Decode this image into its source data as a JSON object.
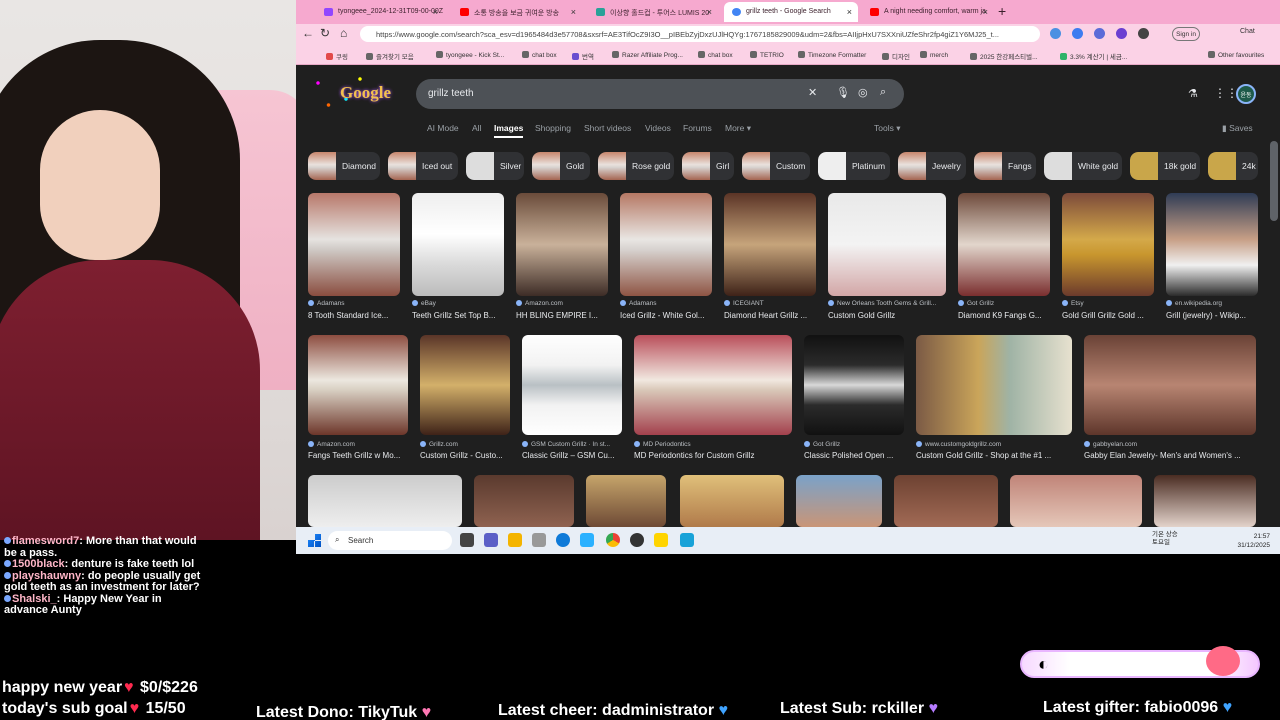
{
  "chat": [
    {
      "user": "flamesword7",
      "text": "More than that would be a pass."
    },
    {
      "user": "1500black",
      "text": "denture is fake teeth lol"
    },
    {
      "user": "playshauwny",
      "text": "do people usually get gold teeth as an investment for later?"
    },
    {
      "user": "Shalski_",
      "text": "Happy New Year in advance Aunty"
    }
  ],
  "overlay": {
    "greeting": "happy new year",
    "greeting_amount": "$0/$226",
    "sub_goal": "today's sub goal",
    "sub_goal_value": "15/50",
    "latest_dono": "Latest Dono: TikyTuk",
    "latest_cheer": "Latest cheer: dadministrator",
    "latest_sub": "Latest Sub: rckiller",
    "latest_gifter": "Latest gifter: fabio0096"
  },
  "browser": {
    "tabs": [
      {
        "title": "tyongeee_2024-12-31T09-00-00Z"
      },
      {
        "title": "소통 방송을 보금 귀여운 방송"
      },
      {
        "title": "이상향 홀드컵 - 투어스 LUMIS 20"
      },
      {
        "title": "grillz teeth - Google Search"
      },
      {
        "title": "A night needing comfort, warm ja"
      }
    ],
    "url": "https://www.google.com/search?sca_esv=d1965484d3e57708&sxsrf=AE3TifOcZ9I3O__pIBEbZyjDxzUJlHQYg:1767185829009&udm=2&fbs=AIIjpHxU7SXXniUZfeShr2fp4giZ1Y6MJ25_t...",
    "signin": "Sign in",
    "chat_btn": "Chat",
    "bookmarks": [
      "쿠링",
      "즐겨찾기 모음",
      "tyongeee - Kick St...",
      "chat box",
      "번역",
      "Razer Affiliate Prog...",
      "chat box",
      "TETRIO",
      "Timezone Formatter",
      "디자인",
      "merch",
      "2025 한강페스티벌...",
      "3.3% 계산기 | 세금..."
    ],
    "other_favourites": "Other favourites"
  },
  "google": {
    "logo": "Google",
    "query": "grillz teeth",
    "tabs": [
      "AI Mode",
      "All",
      "Images",
      "Shopping",
      "Short videos",
      "Videos",
      "Forums",
      "More"
    ],
    "active_tab": "Images",
    "tools": "Tools",
    "saves": "Saves",
    "avatar": "윤동",
    "chips": [
      "Diamond",
      "Iced out",
      "Silver",
      "Gold",
      "Rose gold",
      "Girl",
      "Custom",
      "Platinum",
      "Jewelry",
      "Fangs",
      "White gold",
      "18k gold",
      "24k"
    ],
    "row1": [
      {
        "source": "Adamans",
        "title": "8 Tooth Standard Ice..."
      },
      {
        "source": "eBay",
        "title": "Teeth Grillz Set Top B..."
      },
      {
        "source": "Amazon.com",
        "title": "HH BLING EMPIRE I..."
      },
      {
        "source": "Adamans",
        "title": "Iced Grillz - White Gol..."
      },
      {
        "source": "ICEGIANT",
        "title": "Diamond Heart Grillz ..."
      },
      {
        "source": "New Orleans Tooth Gems & Grill...",
        "title": "Custom Gold Grillz"
      },
      {
        "source": "Got Grillz",
        "title": "Diamond K9 Fangs G..."
      },
      {
        "source": "Etsy",
        "title": "Gold Grill Grillz Gold ..."
      },
      {
        "source": "en.wikipedia.org",
        "title": "Grill (jewelry) - Wikip..."
      }
    ],
    "row2": [
      {
        "source": "Amazon.com",
        "title": "Fangs Teeth Grillz w Mo..."
      },
      {
        "source": "Grillz.com",
        "title": "Custom Grillz - Custo..."
      },
      {
        "source": "GSM Custom Grillz · In st...",
        "title": "Classic Grillz – GSM Cu..."
      },
      {
        "source": "MD Periodontics",
        "title": "MD Periodontics for Custom Grillz"
      },
      {
        "source": "Got Grillz",
        "title": "Classic Polished Open ..."
      },
      {
        "source": "www.customgoldgrillz.com",
        "title": "Custom Gold Grillz - Shop at the #1 ..."
      },
      {
        "source": "gabbyelan.com",
        "title": "Gabby Elan Jewelry- Men's and Women's ..."
      }
    ]
  },
  "taskbar": {
    "search": "Search",
    "weather": "기온 상승",
    "weather_sub": "토요일",
    "time": "21:57",
    "date": "31/12/2025"
  }
}
